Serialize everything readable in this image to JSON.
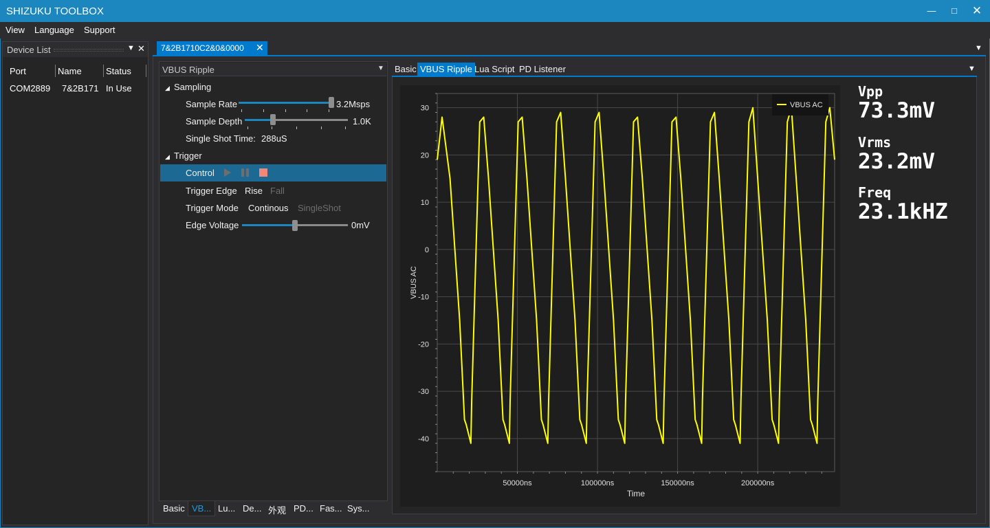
{
  "app": {
    "title": "SHIZUKU TOOLBOX",
    "window_controls": [
      "minimize-icon",
      "maximize-icon",
      "close-icon"
    ]
  },
  "menu": [
    "View",
    "Language",
    "Support"
  ],
  "device_list": {
    "title": "Device List",
    "columns": [
      "Port",
      "Name",
      "Status"
    ],
    "rows": [
      {
        "port": "COM2889",
        "name": "7&2B171(",
        "status": "In Use"
      }
    ]
  },
  "document_tab": {
    "label": "7&2B1710C2&0&0000"
  },
  "config": {
    "panel_select": "VBUS Ripple",
    "sampling": {
      "header": "Sampling",
      "sample_rate": {
        "label": "Sample Rate",
        "value": "3.2Msps",
        "level": 1.0
      },
      "sample_depth": {
        "label": "Sample Depth",
        "value": "1.0K",
        "level": 0.27
      },
      "single_shot": {
        "label": "Single Shot Time:",
        "value": "288uS"
      }
    },
    "trigger": {
      "header": "Trigger",
      "control_label": "Control",
      "edge": {
        "label": "Trigger Edge",
        "options": [
          "Rise",
          "Fall"
        ],
        "selected": "Rise"
      },
      "mode": {
        "label": "Trigger Mode",
        "options": [
          "Continous",
          "SingleShot"
        ],
        "selected": "Continous"
      },
      "edge_voltage": {
        "label": "Edge Voltage",
        "value": "0mV",
        "level": 0.5
      }
    },
    "bottom_tabs": [
      "Basic",
      "VB...",
      "Lu...",
      "De...",
      "外观",
      "PD...",
      "Fas...",
      "Sys..."
    ],
    "bottom_active": 1
  },
  "right_tabs": [
    "Basic",
    "VBUS Ripple",
    "Lua Script",
    "PD Listener"
  ],
  "right_active": 1,
  "measurements": {
    "vpp_label": "Vpp",
    "vpp_value": "73.3mV",
    "vrms_label": "Vrms",
    "vrms_value": "23.2mV",
    "freq_label": "Freq",
    "freq_value": "23.1kHZ"
  },
  "colors": {
    "accent": "#007acc",
    "title_bar": "#1c86bf",
    "trace": "#ffff00",
    "stop": "#f3877a"
  },
  "chart_data": {
    "type": "line",
    "title": "",
    "xlabel": "Time",
    "ylabel": "VBUS AC",
    "x_unit": "ns",
    "xlim": [
      0,
      248000
    ],
    "ylim": [
      -47,
      33
    ],
    "x_ticks": [
      50000,
      100000,
      150000,
      200000
    ],
    "x_tick_labels": [
      "50000ns",
      "100000ns",
      "150000ns",
      "200000ns"
    ],
    "y_ticks": [
      30,
      20,
      10,
      0,
      -10,
      -20,
      -30,
      -40
    ],
    "y_tick_labels": [
      "30",
      "20",
      "10",
      "0",
      "-10",
      "-20",
      "-30",
      "-40"
    ],
    "grid": true,
    "legend_position": "top-right",
    "series": [
      {
        "name": "VBUS AC",
        "x": [
          0,
          3000,
          8000,
          14000,
          17000,
          18000,
          21000,
          21500,
          26500,
          29000,
          32000,
          38000,
          41000,
          42000,
          45000,
          45500,
          50500,
          53000,
          56000,
          62000,
          65000,
          66000,
          69000,
          69500,
          74500,
          77000,
          80000,
          86000,
          89000,
          90000,
          93000,
          93500,
          98500,
          101000,
          104000,
          110000,
          113000,
          114000,
          117000,
          117500,
          122500,
          125000,
          128000,
          134000,
          137000,
          138000,
          141000,
          141500,
          146500,
          149000,
          152000,
          158000,
          161000,
          162000,
          165000,
          165500,
          170500,
          173000,
          176000,
          182000,
          185000,
          186000,
          189000,
          189500,
          194500,
          197000,
          200000,
          206000,
          209000,
          210000,
          213000,
          213500,
          218500,
          221000,
          224000,
          230000,
          233000,
          234000,
          237000,
          237500,
          242500,
          245000,
          248000
        ],
        "y": [
          19,
          28,
          15,
          -15,
          -36,
          -37,
          -41,
          -32,
          27,
          28,
          15,
          -15,
          -36,
          -37,
          -41,
          -32,
          27,
          28,
          15,
          -15,
          -36,
          -37,
          -41,
          -32,
          27,
          29,
          15,
          -15,
          -36,
          -37,
          -41,
          -32,
          27,
          29,
          15,
          -15,
          -36,
          -37,
          -41,
          -32,
          27,
          28,
          15,
          -15,
          -36,
          -37,
          -41,
          -32,
          27,
          28,
          15,
          -15,
          -36,
          -37,
          -41,
          -32,
          27,
          29,
          15,
          -15,
          -36,
          -37,
          -41,
          -32,
          27,
          30,
          15,
          -15,
          -36,
          -37,
          -41,
          -32,
          27,
          30,
          15,
          -15,
          -36,
          -37,
          -41,
          -32,
          27,
          30,
          19
        ]
      }
    ]
  }
}
